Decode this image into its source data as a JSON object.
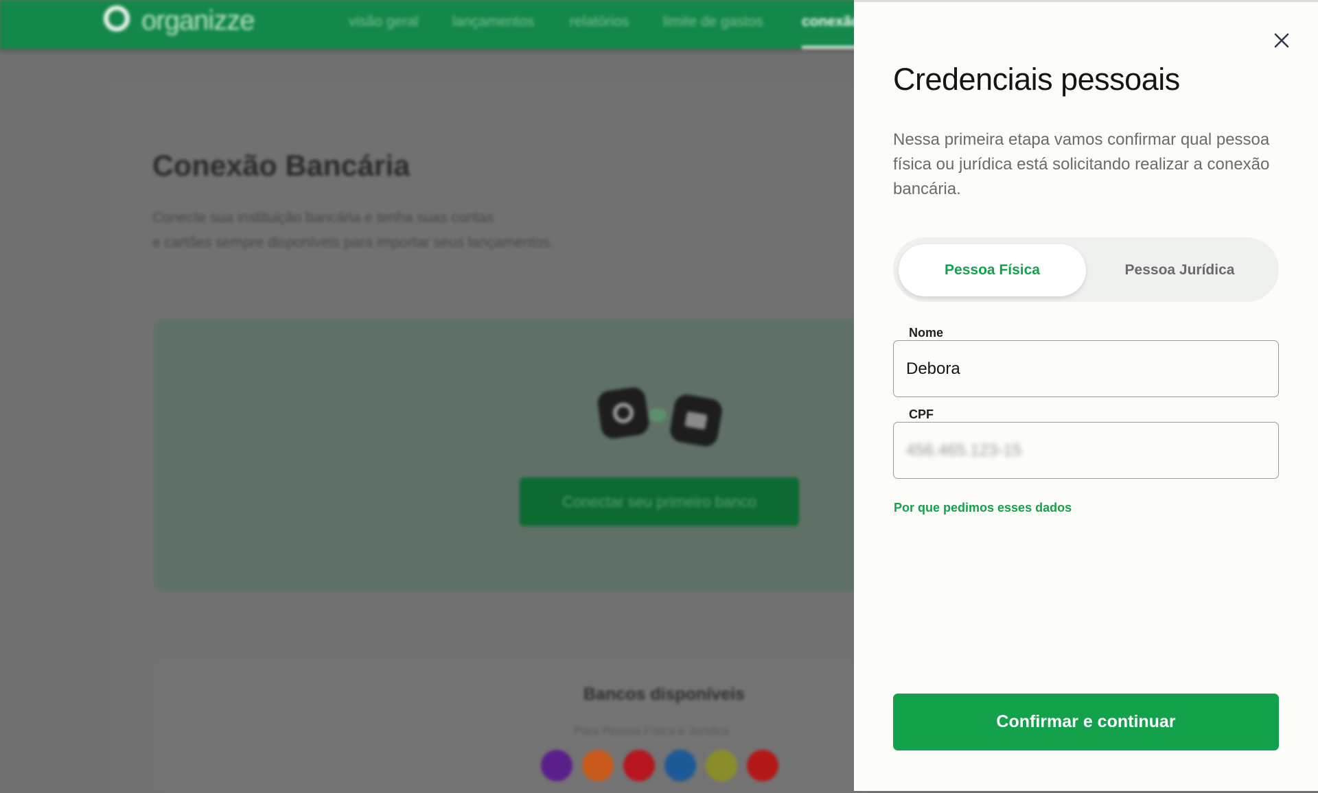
{
  "app": {
    "logo_text": "organizze",
    "nav": [
      "visão geral",
      "lançamentos",
      "relatórios",
      "limite de gastos",
      "conexão"
    ],
    "active_nav_index": 4,
    "brand_color": "#13884a"
  },
  "background_page": {
    "title": "Conexão Bancária",
    "description_line1": "Conecte sua instituição bancária e tenha suas contas",
    "description_line2": "e cartões sempre disponíveis para importar seus lançamentos.",
    "connect_button": "Conectar seu primeiro banco",
    "banks_title": "Bancos disponíveis",
    "banks_subtitle": "Para Pessoa Física e Jurídica",
    "bank_colors": [
      "#5b1f8c",
      "#c8591a",
      "#b5161f",
      "#1c5a97",
      "#8a8d2a",
      "#b41717"
    ]
  },
  "drawer": {
    "close_icon": "close-icon",
    "title": "Credenciais pessoais",
    "description": "Nessa primeira etapa vamos confirmar qual pessoa física ou jurídica está solicitando realizar a conexão bancária.",
    "segment": {
      "options": [
        "Pessoa Física",
        "Pessoa Jurídica"
      ],
      "selected": "Pessoa Física"
    },
    "fields": {
      "nome": {
        "label": "Nome",
        "value": "Debora"
      },
      "cpf": {
        "label": "CPF",
        "value": "456.465.123-15"
      }
    },
    "why_link": "Por que pedimos esses dados",
    "confirm_button": "Confirmar e continuar",
    "accent_color": "#14a14b"
  }
}
